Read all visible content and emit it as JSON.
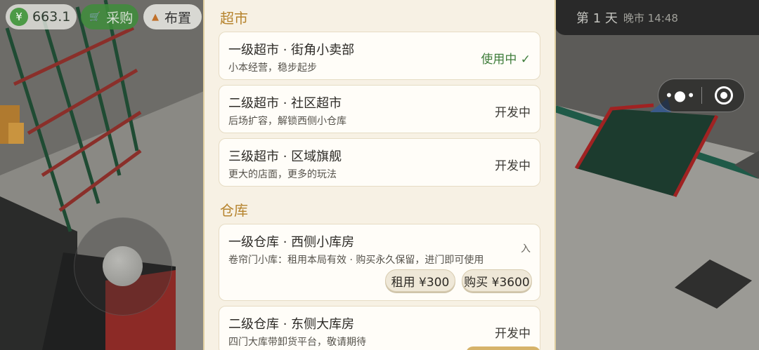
{
  "hud": {
    "money_icon": "¥",
    "money": "663.1",
    "buy_label": "采购",
    "place_label": "布置",
    "day_label": "第 1 天",
    "time_label": "晚市 14:48"
  },
  "capsule": {
    "menu_icon": "more-dots-icon",
    "close_icon": "target-circle-icon"
  },
  "panel": {
    "sections": [
      {
        "title": "超市",
        "items": [
          {
            "name": "一级超市 · 街角小卖部",
            "desc": "小本经营，稳步起步",
            "status": "使用中 ✓"
          },
          {
            "name": "二级超市 · 社区超市",
            "desc": "后场扩容，解锁西侧小仓库",
            "status": "开发中"
          },
          {
            "name": "三级超市 · 区域旗舰",
            "desc": "更大的店面，更多的玩法",
            "status": "开发中"
          }
        ]
      },
      {
        "title": "仓库",
        "items": [
          {
            "name": "一级仓库 · 西侧小库房",
            "desc": "卷帘门小库：租用本局有效 · 购买永久保留，进门即可使用",
            "partial": "入",
            "rent_label": "租用 ¥300",
            "buy_label": "购买 ¥3600"
          },
          {
            "name": "二级仓库 · 东侧大库房",
            "desc": "四门大库带卸货平台，敬请期待",
            "status": "开发中"
          }
        ]
      }
    ]
  },
  "colors": {
    "accent_gold": "#b6842e",
    "active_green": "#3f7d3b",
    "panel_bg": "#f7f1e4"
  }
}
